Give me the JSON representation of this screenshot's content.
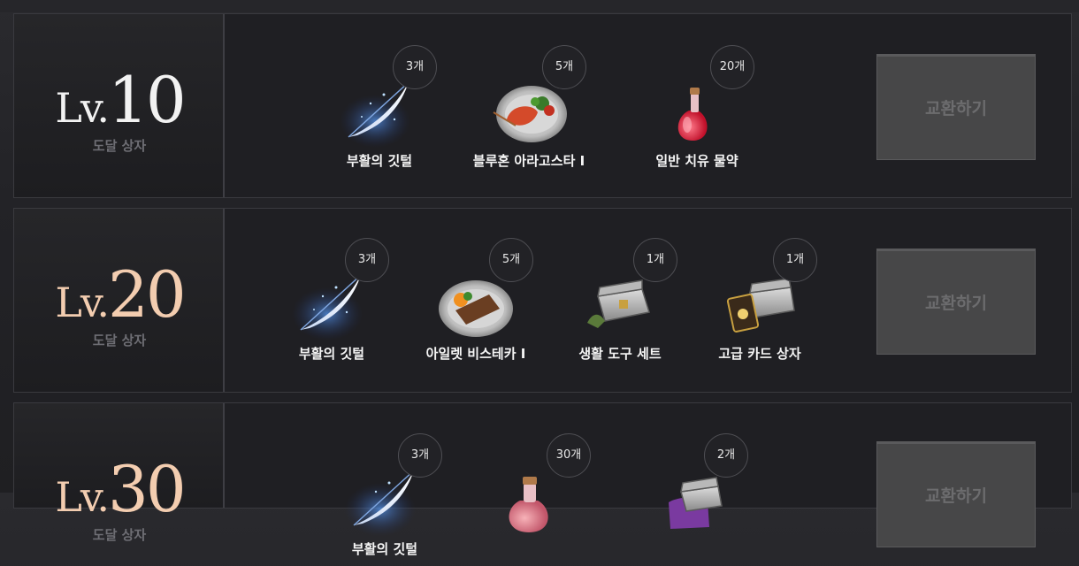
{
  "rows": [
    {
      "level_prefix": "Lv.",
      "level_number": "10",
      "reach_label": "도달 상자",
      "exchange_label": "교환하기",
      "items": [
        {
          "name": "부활의 깃털",
          "count": "3개",
          "icon": "feather-icon"
        },
        {
          "name": "블루혼 아라고스타 Ⅰ",
          "count": "5개",
          "icon": "lobster-dish-icon"
        },
        {
          "name": "일반 치유 물약",
          "count": "20개",
          "icon": "red-potion-icon"
        }
      ]
    },
    {
      "level_prefix": "Lv.",
      "level_number": "20",
      "reach_label": "도달 상자",
      "exchange_label": "교환하기",
      "items": [
        {
          "name": "부활의 깃털",
          "count": "3개",
          "icon": "feather-icon"
        },
        {
          "name": "아일렛 비스테카 Ⅰ",
          "count": "5개",
          "icon": "steak-dish-icon"
        },
        {
          "name": "생활 도구 세트",
          "count": "1개",
          "icon": "tool-chest-icon"
        },
        {
          "name": "고급 카드 상자",
          "count": "1개",
          "icon": "card-chest-icon"
        }
      ]
    },
    {
      "level_prefix": "Lv.",
      "level_number": "30",
      "reach_label": "도달 상자",
      "exchange_label": "교환하기",
      "items": [
        {
          "name": "부활의 깃털",
          "count": "3개",
          "icon": "feather-icon"
        },
        {
          "name": "",
          "count": "30개",
          "icon": "pink-potion-icon"
        },
        {
          "name": "",
          "count": "2개",
          "icon": "purple-chest-icon"
        }
      ]
    }
  ]
}
